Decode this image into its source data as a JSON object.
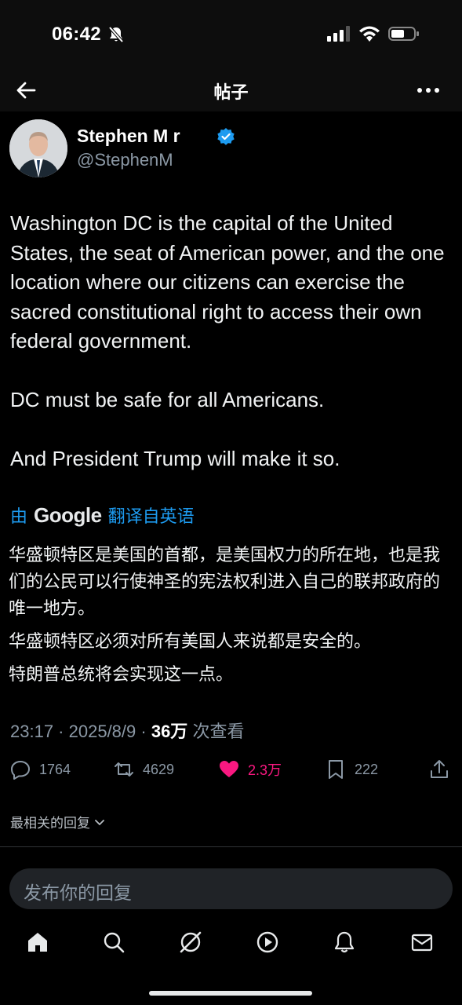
{
  "status_bar": {
    "time": "06:42"
  },
  "header": {
    "title": "帖子"
  },
  "author": {
    "name": "Stephen M    r",
    "handle": "@StephenM"
  },
  "tweet": {
    "paragraphs": [
      "Washington DC is the capital of the United States, the seat of American power, and the one location where our citizens can exercise the sacred constitutional right to access their own federal government.",
      "DC must be safe for all Americans.",
      "And President Trump will make it so."
    ]
  },
  "translation": {
    "prefix": "由",
    "provider": "Google",
    "suffix": "翻译自英语",
    "paragraphs": [
      "华盛顿特区是美国的首都，是美国权力的所在地，也是我们的公民可以行使神圣的宪法权利进入自己的联邦政府的唯一地方。",
      "华盛顿特区必须对所有美国人来说都是安全的。",
      "特朗普总统将会实现这一点。"
    ]
  },
  "meta": {
    "time": "23:17",
    "date": "2025/8/9",
    "views": "36万",
    "views_label": "次查看"
  },
  "actions": {
    "replies": "1764",
    "reposts": "4629",
    "likes": "2.3万",
    "bookmarks": "222"
  },
  "sort": {
    "label": "最相关的回复"
  },
  "reply": {
    "placeholder": "发布你的回复"
  },
  "colors": {
    "accent": "#1d9bf0",
    "like": "#f91880",
    "background": "#000000"
  }
}
